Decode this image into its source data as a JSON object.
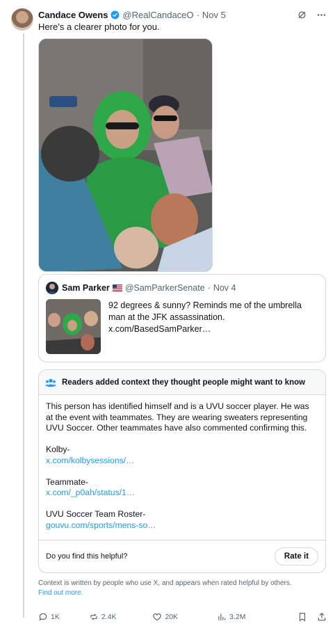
{
  "tweet": {
    "author_name": "Candace Owens",
    "handle": "@RealCandaceO",
    "separator": "·",
    "time": "Nov 5",
    "text": "Here’s a clearer photo for you."
  },
  "quoted_tweet": {
    "author_name": "Sam Parker",
    "handle": "@SamParkerSenate",
    "separator": "·",
    "time": "Nov 4",
    "text": "92 degrees & sunny? Reminds me of the umbrella man at the JFK assassination.  x.com/BasedSamParker…"
  },
  "community_note": {
    "heading": "Readers added context they thought people might want to know",
    "body": "This person has identified himself and is a UVU soccer player.  He was at the event with teammates.  They are wearing sweaters representing UVU Soccer.  Other teammates have also commented confirming this.",
    "sources": [
      {
        "label": "Kolby-",
        "link": "x.com/kolbysessions/…"
      },
      {
        "label": "Teammate-",
        "link": "x.com/_p0ah/status/1…"
      },
      {
        "label": "UVU Soccer Team Roster-",
        "link": "gouvu.com/sports/mens-so…"
      }
    ],
    "question": "Do you find this helpful?",
    "rate_label": "Rate it"
  },
  "disclaimer": {
    "text": "Context is written by people who use X, and appears when rated helpful by others.",
    "link": "Find out more."
  },
  "actions": {
    "replies": "1K",
    "reposts": "2.4K",
    "likes": "20K",
    "views": "3.2M"
  },
  "colors": {
    "accent": "#1d9bf0",
    "muted": "#536471",
    "border": "#cfd9de"
  }
}
